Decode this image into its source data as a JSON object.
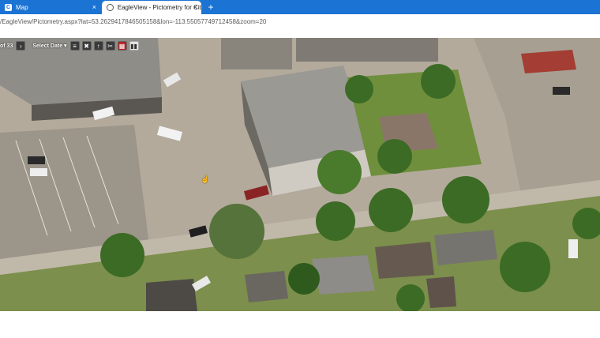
{
  "tabs": [
    {
      "label": "Map",
      "icon": "map-app-icon",
      "glyph": "C",
      "close": "×"
    },
    {
      "label": "EagleView - Pictometry for City",
      "icon": "globe-icon",
      "close": "×"
    }
  ],
  "new_tab_label": "+",
  "address": {
    "url": "/EagleView/Pictometry.aspx?lat=53.2629417846505158&lon=-113.55057749712458&zoom=20"
  },
  "toolbar": {
    "page_count": "of 33",
    "next_glyph": "›",
    "select_date_label": "Select Date",
    "select_date_caret": "▾",
    "tools": [
      {
        "name": "layers-icon",
        "glyph": "≡"
      },
      {
        "name": "measure-tools-icon",
        "glyph": "✖"
      },
      {
        "name": "height-measure-icon",
        "glyph": "↑"
      },
      {
        "name": "clear-measure-icon",
        "glyph": "✂"
      },
      {
        "name": "calendar-icon",
        "glyph": "▦"
      },
      {
        "name": "split-view-icon",
        "glyph": "▮▮"
      }
    ]
  },
  "colors": {
    "tabbar": "#1b73d3",
    "ground": "#b3aa9c",
    "grass": "#6f8f3c",
    "tree": "#3c6b25",
    "roof": "#8f8f8c"
  }
}
